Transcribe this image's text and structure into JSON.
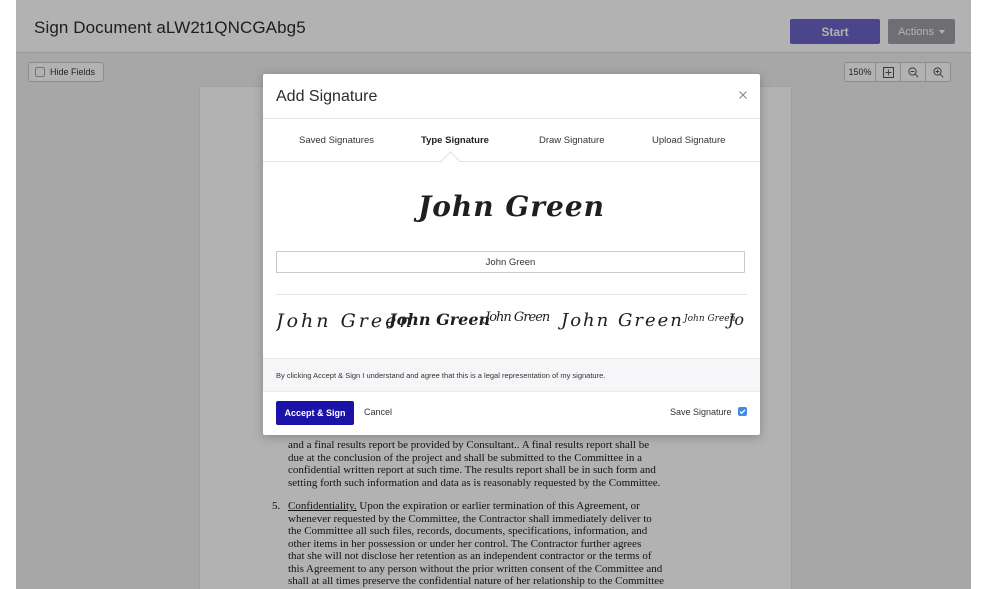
{
  "header": {
    "title": "Sign Document aLW2t1QNCGAbg5",
    "start_label": "Start",
    "actions_label": "Actions"
  },
  "toolbar": {
    "hide_fields_label": "Hide Fields",
    "zoom_level": "150%"
  },
  "document": {
    "lines": [
      "and a final results report be provided by Consultant..  A final results report shall be",
      "due at the conclusion of the project and shall be submitted to the Committee in a",
      "confidential written report at such time.  The results report shall be in such form and",
      "setting forth such information and data as is reasonably requested by the Committee."
    ],
    "item5_number": "5.",
    "item5_heading": "Confidentiality.",
    "item5_first": "  Upon the expiration or earlier termination of this Agreement, or",
    "item5_lines": [
      "whenever requested by the Committee, the Contractor shall immediately deliver to",
      "the Committee all such files, records, documents, specifications, information, and",
      "other items in her possession or under her control.  The Contractor further agrees",
      "that she will not disclose her retention as an independent contractor or the terms of",
      "this Agreement to any person without the prior written consent of the Committee and",
      "shall at all times preserve the confidential nature of her relationship to the Committee"
    ]
  },
  "modal": {
    "title": "Add Signature",
    "tabs": [
      {
        "label": "Saved Signatures",
        "active": false
      },
      {
        "label": "Type Signature",
        "active": true
      },
      {
        "label": "Draw Signature",
        "active": false
      },
      {
        "label": "Upload Signature",
        "active": false
      }
    ],
    "signature_preview": "John Green",
    "name_value": "John Green",
    "style_samples": [
      "John Green",
      "John Green",
      "John Green",
      "John Green",
      "John Green",
      "Jo"
    ],
    "legal_text": "By clicking Accept & Sign I understand and agree that this is a legal representation of my signature.",
    "accept_label": "Accept & Sign",
    "cancel_label": "Cancel",
    "save_signature_label": "Save Signature",
    "save_signature_checked": true
  },
  "colors": {
    "start_button": "#6a63c9",
    "accept_button": "#1b12a8",
    "checkbox": "#3d8ee8"
  }
}
